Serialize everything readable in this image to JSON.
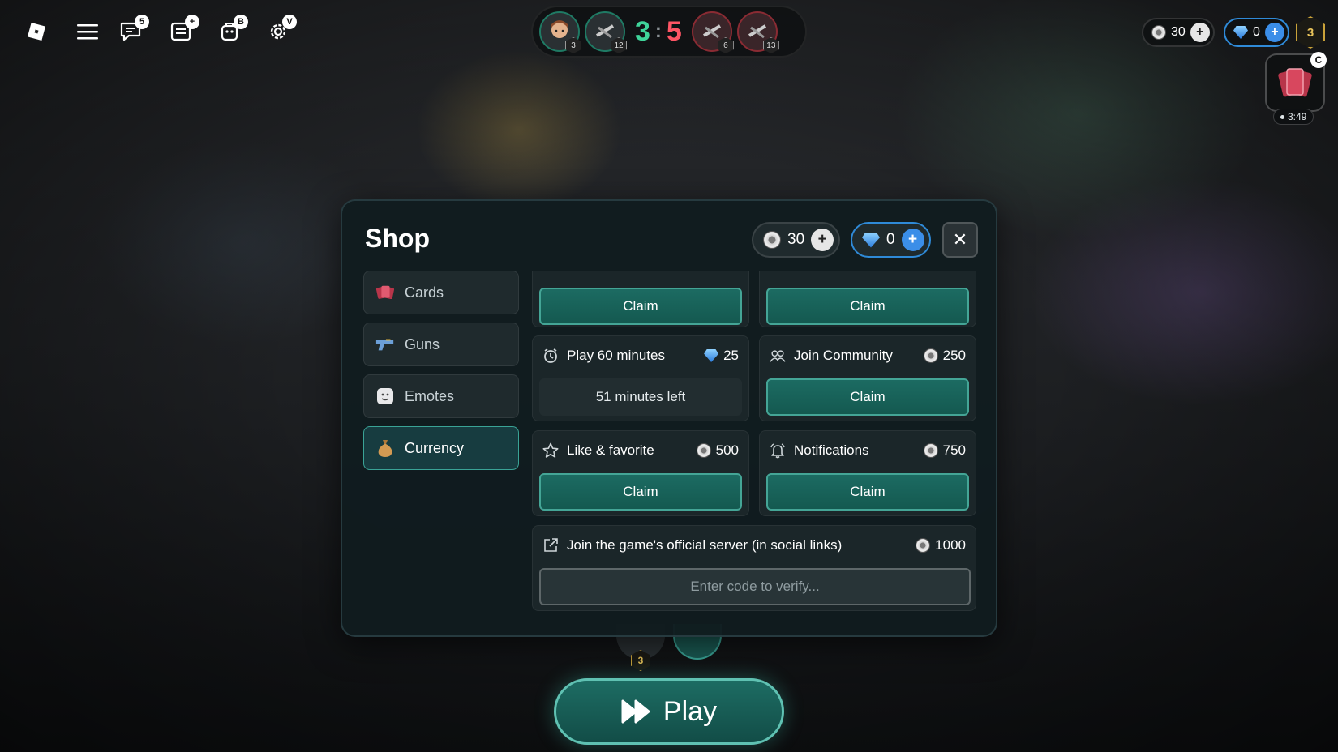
{
  "top_left": {
    "badges": {
      "chat": "5",
      "list": "+",
      "shop": "B",
      "settings": "V"
    }
  },
  "scoreboard": {
    "team_green_score": "3",
    "team_red_score": "5",
    "separator": ":",
    "players_left": [
      {
        "level": "3"
      },
      {
        "level": "12"
      }
    ],
    "players_right": [
      {
        "level": "6"
      },
      {
        "level": "13"
      }
    ]
  },
  "top_right": {
    "coins": "30",
    "gems": "0",
    "level": "3",
    "pack_badge": "C",
    "pack_timer": "3:49"
  },
  "shop": {
    "title": "Shop",
    "coins": "30",
    "gems": "0",
    "close_glyph": "✕",
    "sidebar": [
      {
        "label": "Cards",
        "icon": "cards-icon"
      },
      {
        "label": "Guns",
        "icon": "gun-icon"
      },
      {
        "label": "Emotes",
        "icon": "emote-icon"
      },
      {
        "label": "Currency",
        "icon": "money-bag-icon",
        "active": true
      }
    ],
    "tasks": {
      "top_left": {
        "button": "Claim"
      },
      "top_right": {
        "button": "Claim"
      },
      "play60": {
        "title": "Play 60 minutes",
        "reward": "25",
        "reward_type": "gem",
        "status": "51 minutes left"
      },
      "community": {
        "title": "Join Community",
        "reward": "250",
        "reward_type": "coin",
        "button": "Claim"
      },
      "like": {
        "title": "Like & favorite",
        "reward": "500",
        "reward_type": "coin",
        "button": "Claim"
      },
      "notifications": {
        "title": "Notifications",
        "reward": "750",
        "reward_type": "coin",
        "button": "Claim"
      },
      "server": {
        "title": "Join the game's official server (in social links)",
        "reward": "1000",
        "reward_type": "coin",
        "placeholder": "Enter code to verify..."
      }
    }
  },
  "under_modal": {
    "level": "3"
  },
  "play_button": {
    "label": "Play"
  },
  "colors": {
    "accent": "#44a596",
    "green_score": "#3fd49a",
    "red_score": "#ff5565",
    "gem_blue": "#2f8ad8"
  }
}
